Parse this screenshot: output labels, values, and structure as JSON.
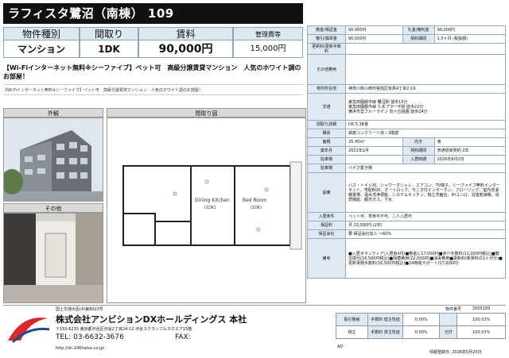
{
  "title": "ラフィスタ鷺沼（南棟） 109",
  "summary": {
    "headers": [
      "物件種別",
      "間取り",
      "賃料",
      "管理費等"
    ],
    "values": [
      "マンション",
      "1DK",
      "90,000円",
      "15,000円"
    ]
  },
  "catch_copy": "【Wi-Fiインターネット無料※シーファイブ】ペット可　高級分譲賃貸マンション　人気のホワイト調のお部屋！",
  "sub_line": "【Wi-Fiインターネット無料※シーファイブ】ペット可　高級分譲賃貸マンション　人気のホワイト調のお部屋！",
  "photos": {
    "exterior_label": "外観",
    "other_label": "その他",
    "floorplan_label": "間取り図"
  },
  "floorplan": {
    "room1": "Dining Kitchen",
    "room1_size": "(1DK)",
    "room2": "Bed Room",
    "room2_size": "(1DK)"
  },
  "spec": {
    "rows_top": [
      {
        "k1": "敷金/保証金",
        "v1": "90,000円",
        "k2": "礼金/権利金",
        "v2": "90,000円"
      },
      {
        "k1": "敷引/償却金",
        "v1": "90,000円",
        "k2": "契約期間",
        "v2": "1.5ヶ月 (税抜額)"
      }
    ],
    "renewal_label": "更新料/更新手数料",
    "other_label": "その他費用",
    "address_label": "物件所在地",
    "address": "神奈川県川崎市宮前区有馬4丁目2-19",
    "traffic_label": "交通",
    "traffic": [
      "東急田園都市線 鷺沼駅 徒歩10分",
      "東急田園都市線 たまプラーザ駅 徒歩22分",
      "横浜市営ブルーライン 向ヶ丘遊園 徒歩24分"
    ],
    "structure_label": "間取り詳細",
    "structure": "DK 5.3B畳",
    "rows_mid": [
      {
        "k1": "構造",
        "v1": "鉄筋コンクリート造 / 3階建",
        "k2": "",
        "v2": ""
      },
      {
        "k1": "面積",
        "v1": "25.45m²",
        "k2": "向き",
        "v2": "南"
      },
      {
        "k1": "築年月",
        "v1": "2021年1月",
        "k2": "契約期間",
        "v2": "普通借家契約 2年"
      },
      {
        "k1": "駐車場",
        "v1": "",
        "k2": "入居時期",
        "v2": "2026年6月2日"
      }
    ],
    "parking_label": "駐車場",
    "parking": "バイク置き場",
    "equipment_label": "設備",
    "equipment": "バス・トイレ別、シャワーオシャレ、エアコン、TV端子、シーファイブ無料インターネット、宅配BOX、オートロック、モニタ付インターホン、フローリング、室内洗濯機置場、温水洗浄便座、システムキッチン、独立洗面台、IHコンロ、浴室乾燥機、追焚機能、都市ガス、下水",
    "conditions_label": "入居条件",
    "conditions": "ペット可、単身可不可、二人入居可",
    "guarantee_label": "保証料",
    "guarantee": "月 23,000円 (2年)",
    "insurance_label": "保証会社",
    "insurance": "要 保証会社加入 ～60%",
    "remarks_label": "備考",
    "remarks": "■入居ボランティア(入居後4月)■敷金に17,000円■仲介手数料(11,000円税込)■鍵交換代(16,500円税込)■除菌費用(22,000円)■消毒費用■更新料(新賃料の1ヶ月分)■更新事務手数料(16,500円税込)■24時間サポート(17,600円)"
  },
  "footer": {
    "license": "国土交通大臣(4)第8023号",
    "company": "株式会社アンビションDXホールディングス 本社",
    "address": "〒150-6215 東京都渋谷区渋谷2丁目24-12 渋谷スクランブルスクエア15階",
    "tel": "TEL: 03-6632-3676",
    "fax": "FAX:",
    "url": "http://sh.106hatsu.co.jp/",
    "property_no_label": "物件番号",
    "property_no": "2005109",
    "mode_label": "取引態様",
    "mode": "貸主",
    "fee_rows": [
      {
        "k": "手数料 借主負担",
        "p1": "0.00%",
        "k2": "",
        "p2": "100.03%"
      },
      {
        "k": "手数料 貸主負担",
        "p1": "0.00%",
        "k2": "元付",
        "p2": "100.03%"
      }
    ],
    "ad_label": "AD:",
    "date": "情報登録日: 2026年5月25日"
  }
}
